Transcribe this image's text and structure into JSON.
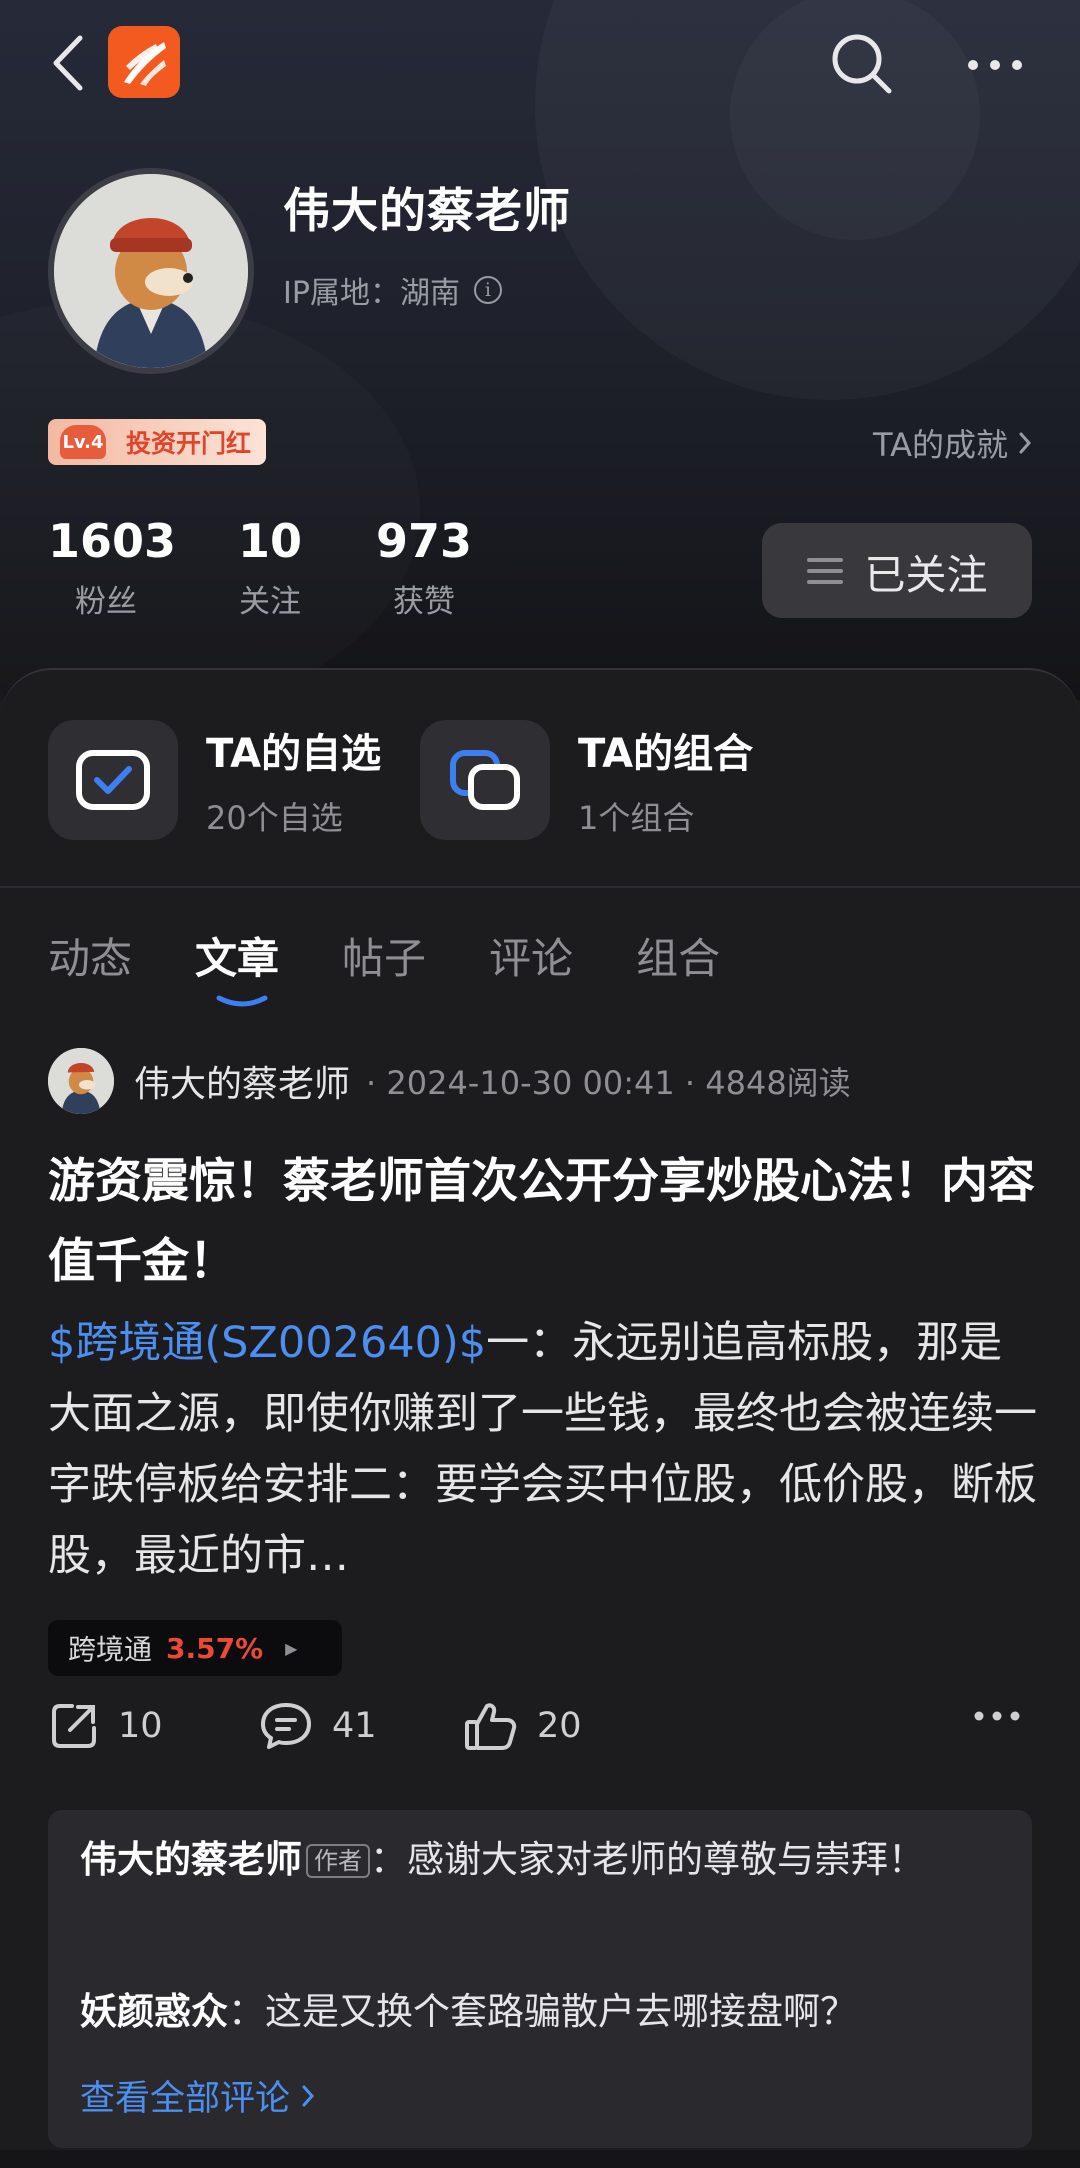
{
  "profile": {
    "name": "伟大的蔡老师",
    "ip_location": "IP属地：湖南",
    "level": "Lv.4",
    "badge": "投资开门红",
    "achievements_link": "TA的成就",
    "stats": [
      {
        "value": "1603",
        "label": "粉丝"
      },
      {
        "value": "10",
        "label": "关注"
      },
      {
        "value": "973",
        "label": "获赞"
      }
    ],
    "follow_button": "已关注"
  },
  "quick_links": [
    {
      "title": "TA的自选",
      "subtitle": "20个自选",
      "icon": "watchlist-check-icon"
    },
    {
      "title": "TA的组合",
      "subtitle": "1个组合",
      "icon": "portfolio-icon"
    }
  ],
  "tabs": [
    "动态",
    "文章",
    "帖子",
    "评论",
    "组合"
  ],
  "active_tab": "文章",
  "post": {
    "author": "伟大的蔡老师",
    "meta": "· 2024-10-30 00:41 · 4848阅读",
    "title": "游资震惊！蔡老师首次公开分享炒股心法！内容值千金！",
    "stock_tag": "$跨境通(SZ002640)$",
    "body_text": "一：永远别追高标股，那是大面之源，即使你赚到了一些钱，最终也会被连续一字跌停板给安排二：要学会买中位股，低价股，断板股，最近的市…",
    "stock_chip": {
      "name": "跨境通",
      "change": "3.57%"
    },
    "actions": {
      "share": "10",
      "comment": "41",
      "like": "20"
    },
    "comments": [
      {
        "user": "伟大的蔡老师",
        "tag": "作者",
        "text": "：感谢大家对老师的尊敬与崇拜！"
      },
      {
        "user": "妖颜惑众",
        "text": "：这是又换个套路骗散户去哪接盘啊？"
      }
    ],
    "view_all": "查看全部评论"
  },
  "colors": {
    "accent_blue": "#4c8ff0",
    "up_red": "#ec4a36",
    "brand_orange": "#f25a1f",
    "background": "#1c1c1e"
  }
}
